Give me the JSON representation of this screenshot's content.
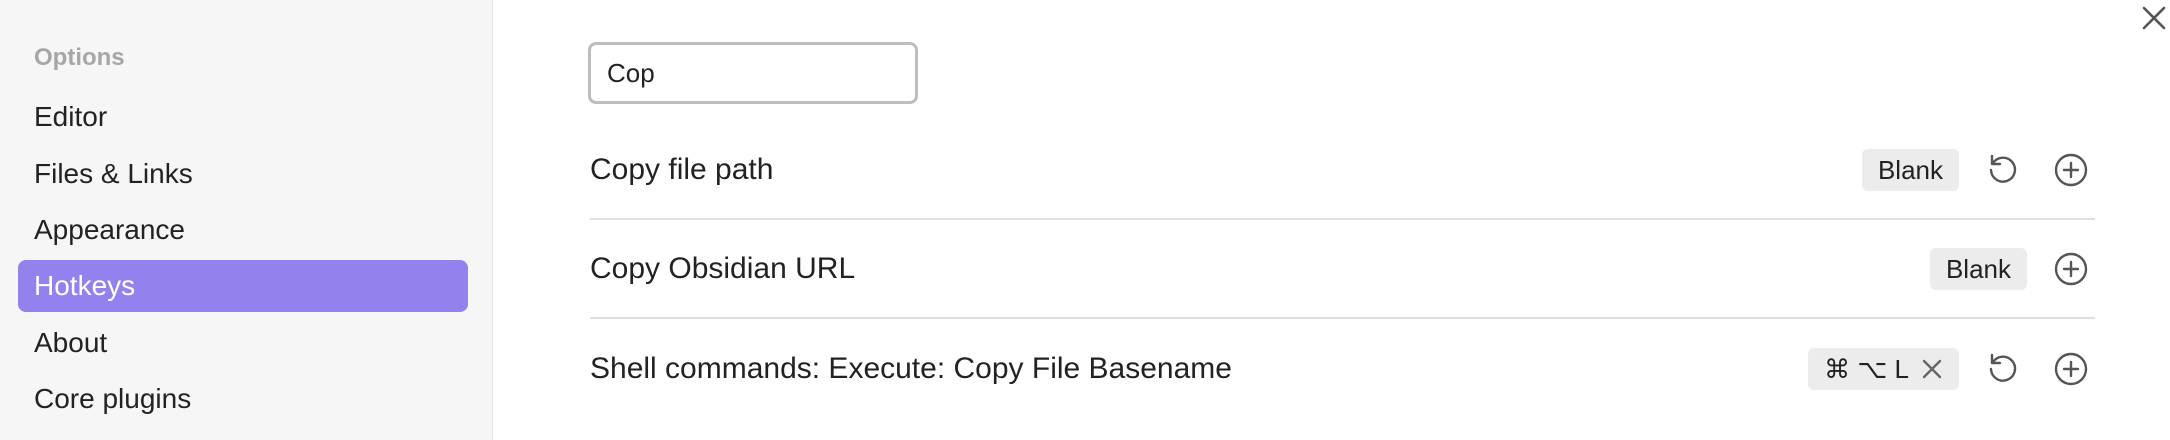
{
  "sidebar": {
    "heading": "Options",
    "items": [
      {
        "label": "Editor",
        "active": false
      },
      {
        "label": "Files & Links",
        "active": false
      },
      {
        "label": "Appearance",
        "active": false
      },
      {
        "label": "Hotkeys",
        "active": true
      },
      {
        "label": "About",
        "active": false
      },
      {
        "label": "Core plugins",
        "active": false
      }
    ]
  },
  "search": {
    "value": "Cop"
  },
  "hotkeys": [
    {
      "label": "Copy file path",
      "hotkey": "Blank",
      "has_reset": true
    },
    {
      "label": "Copy Obsidian URL",
      "hotkey": "Blank",
      "has_reset": false
    },
    {
      "label": "Shell commands: Execute: Copy File Basename",
      "hotkey": "⌘ ⌥ L",
      "has_reset": true,
      "removable": true
    }
  ],
  "icons": {
    "close": "close-icon",
    "reset": "reset-icon",
    "add": "plus-circle-icon",
    "remove_hotkey": "x-icon"
  },
  "colors": {
    "accent": "#9382ee",
    "sidebar_bg": "#f6f6f6",
    "chip_bg": "#ececec"
  }
}
